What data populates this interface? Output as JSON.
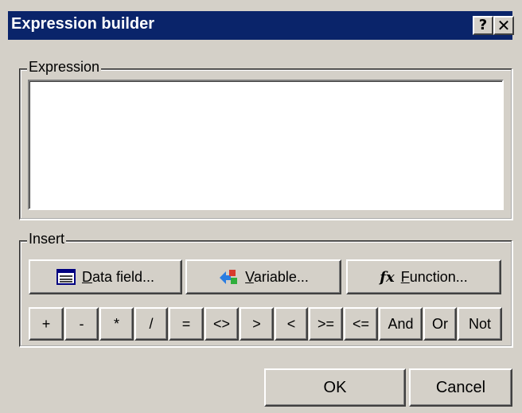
{
  "window": {
    "title": "Expression builder",
    "help_glyph": "?",
    "close_glyph": "✕"
  },
  "expression": {
    "group_label": "Expression",
    "value": ""
  },
  "insert": {
    "group_label": "Insert",
    "buttons": [
      {
        "label": "Data field...",
        "icon": "table-icon"
      },
      {
        "label": "Variable...",
        "icon": "variable-icon"
      },
      {
        "label": "Function...",
        "icon": "function-fx-icon",
        "icon_text": "fx"
      }
    ],
    "operators": [
      "+",
      "-",
      "*",
      "/",
      "=",
      "<>",
      ">",
      "<",
      ">=",
      "<=",
      "And",
      "Or",
      "Not"
    ]
  },
  "footer": {
    "ok_label": "OK",
    "cancel_label": "Cancel"
  }
}
